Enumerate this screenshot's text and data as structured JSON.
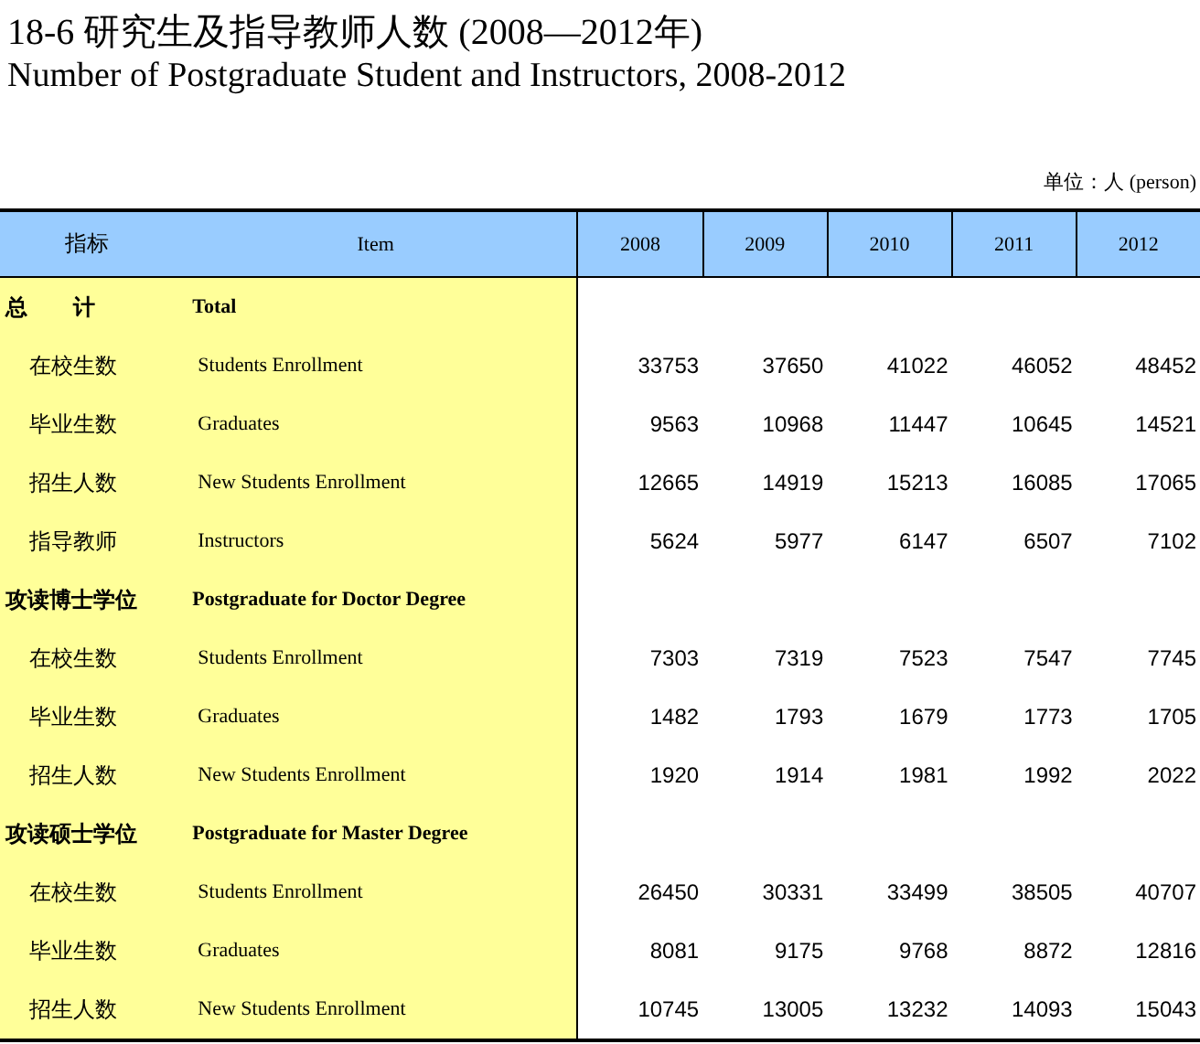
{
  "title_zh": "18-6 研究生及指导教师人数 (2008—2012年)",
  "title_en": "Number of Postgraduate Student and Instructors, 2008-2012",
  "unit": "单位：人 (person)",
  "table": {
    "columns": [
      "指标",
      "Item",
      "2008",
      "2009",
      "2010",
      "2011",
      "2012"
    ],
    "rows": [
      {
        "kind": "group",
        "label_zh": "总      计",
        "label_en": "Total",
        "values": []
      },
      {
        "kind": "item",
        "label_zh": "在校生数",
        "label_en": "Students Enrollment",
        "values": [
          "33753",
          "37650",
          "41022",
          "46052",
          "48452"
        ]
      },
      {
        "kind": "item",
        "label_zh": "毕业生数",
        "label_en": "Graduates",
        "values": [
          "9563",
          "10968",
          "11447",
          "10645",
          "14521"
        ]
      },
      {
        "kind": "item",
        "label_zh": "招生人数",
        "label_en": "New Students Enrollment",
        "values": [
          "12665",
          "14919",
          "15213",
          "16085",
          "17065"
        ]
      },
      {
        "kind": "item",
        "label_zh": "指导教师",
        "label_en": "Instructors",
        "values": [
          "5624",
          "5977",
          "6147",
          "6507",
          "7102"
        ]
      },
      {
        "kind": "group",
        "label_zh": "攻读博士学位",
        "label_en": "Postgraduate for Doctor Degree",
        "values": []
      },
      {
        "kind": "item",
        "label_zh": "在校生数",
        "label_en": "Students Enrollment",
        "values": [
          "7303",
          "7319",
          "7523",
          "7547",
          "7745"
        ]
      },
      {
        "kind": "item",
        "label_zh": "毕业生数",
        "label_en": "Graduates",
        "values": [
          "1482",
          "1793",
          "1679",
          "1773",
          "1705"
        ]
      },
      {
        "kind": "item",
        "label_zh": "招生人数",
        "label_en": "New Students Enrollment",
        "values": [
          "1920",
          "1914",
          "1981",
          "1992",
          "2022"
        ]
      },
      {
        "kind": "group",
        "label_zh": "攻读硕士学位",
        "label_en": "Postgraduate for Master Degree",
        "values": []
      },
      {
        "kind": "item",
        "label_zh": "在校生数",
        "label_en": "Students Enrollment",
        "values": [
          "26450",
          "30331",
          "33499",
          "38505",
          "40707"
        ]
      },
      {
        "kind": "item",
        "label_zh": "毕业生数",
        "label_en": "Graduates",
        "values": [
          "8081",
          "9175",
          "9768",
          "8872",
          "12816"
        ]
      },
      {
        "kind": "item",
        "label_zh": "招生人数",
        "label_en": "New Students Enrollment",
        "values": [
          "10745",
          "13005",
          "13232",
          "14093",
          "15043"
        ]
      }
    ]
  }
}
